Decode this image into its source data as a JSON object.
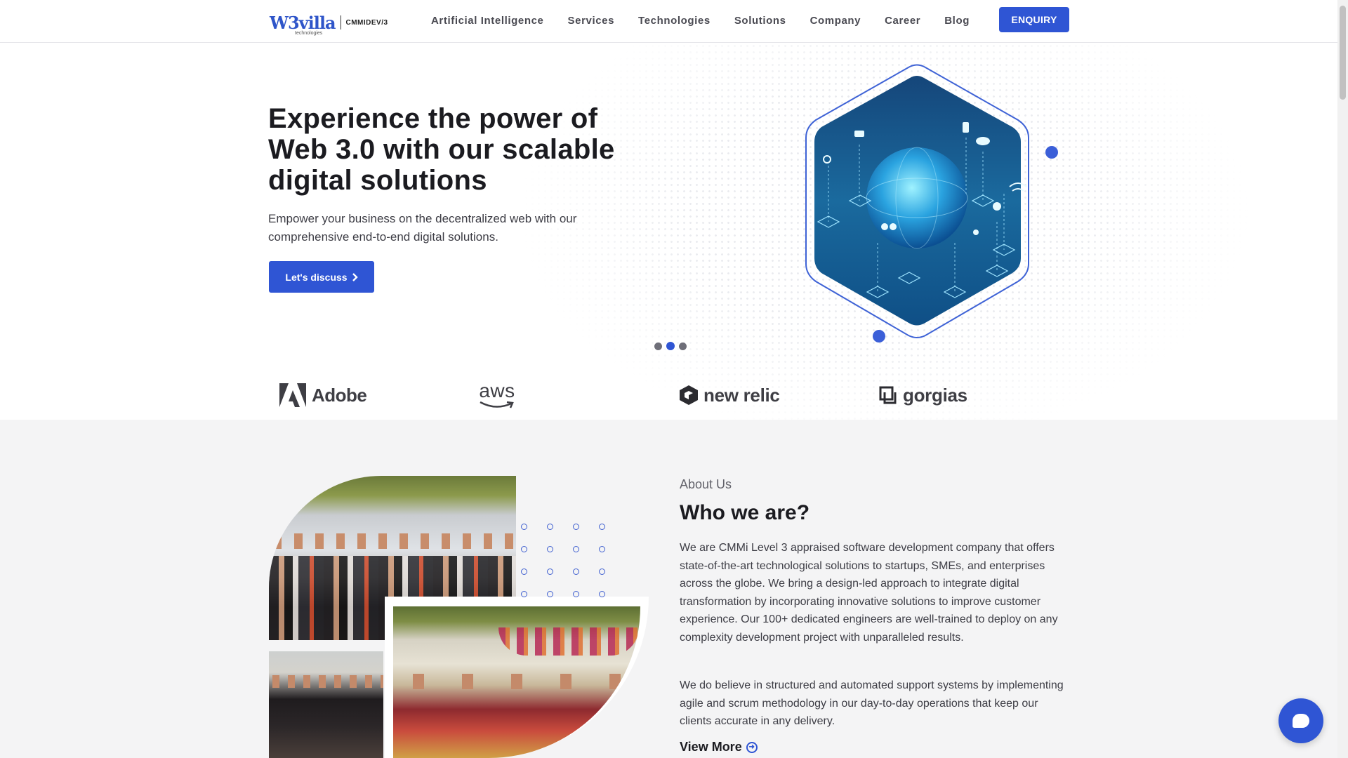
{
  "header": {
    "logo": {
      "brand": "W3villa",
      "sub": "technologies",
      "badge": "CMMIDEV/3"
    },
    "nav": [
      {
        "label": "Artificial Intelligence"
      },
      {
        "label": "Services"
      },
      {
        "label": "Technologies"
      },
      {
        "label": "Solutions"
      },
      {
        "label": "Company"
      },
      {
        "label": "Career"
      },
      {
        "label": "Blog"
      }
    ],
    "enquiry_label": "ENQUIRY"
  },
  "hero": {
    "title": "Experience the power of Web 3.0 with our scalable digital solutions",
    "subtitle": "Empower your business on the decentralized web with our comprehensive end-to-end digital solutions.",
    "cta_label": "Let's discuss",
    "cta_icon": "chevron-right-icon",
    "carousel": {
      "count": 3,
      "active": 2
    }
  },
  "clients": [
    {
      "name": "Adobe",
      "icon": "adobe-logo-icon"
    },
    {
      "name": "aws",
      "icon": "aws-smile-icon"
    },
    {
      "name": "new relic",
      "icon": "new-relic-logo-icon"
    },
    {
      "name": "gorgias",
      "icon": "gorgias-logo-icon"
    }
  ],
  "about": {
    "label": "About Us",
    "title": "Who we are?",
    "paragraphs": [
      "We are CMMi Level 3 appraised software development company that offers state-of-the-art technological solutions to startups, SMEs, and enterprises across the globe. We bring a design-led approach to integrate digital transformation by incorporating innovative solutions to improve customer experience. Our 100+ dedicated engineers are well-trained to deploy on any complexity development project with unparalleled results.",
      "We do believe in structured and automated support systems by implementing agile and scrum methodology in our day-to-day operations that keep our clients accurate in any delivery."
    ],
    "view_more_label": "View More"
  },
  "colors": {
    "accent": "#2f55d4",
    "text": "#1b1b20",
    "about_bg": "#f4f4f5"
  }
}
